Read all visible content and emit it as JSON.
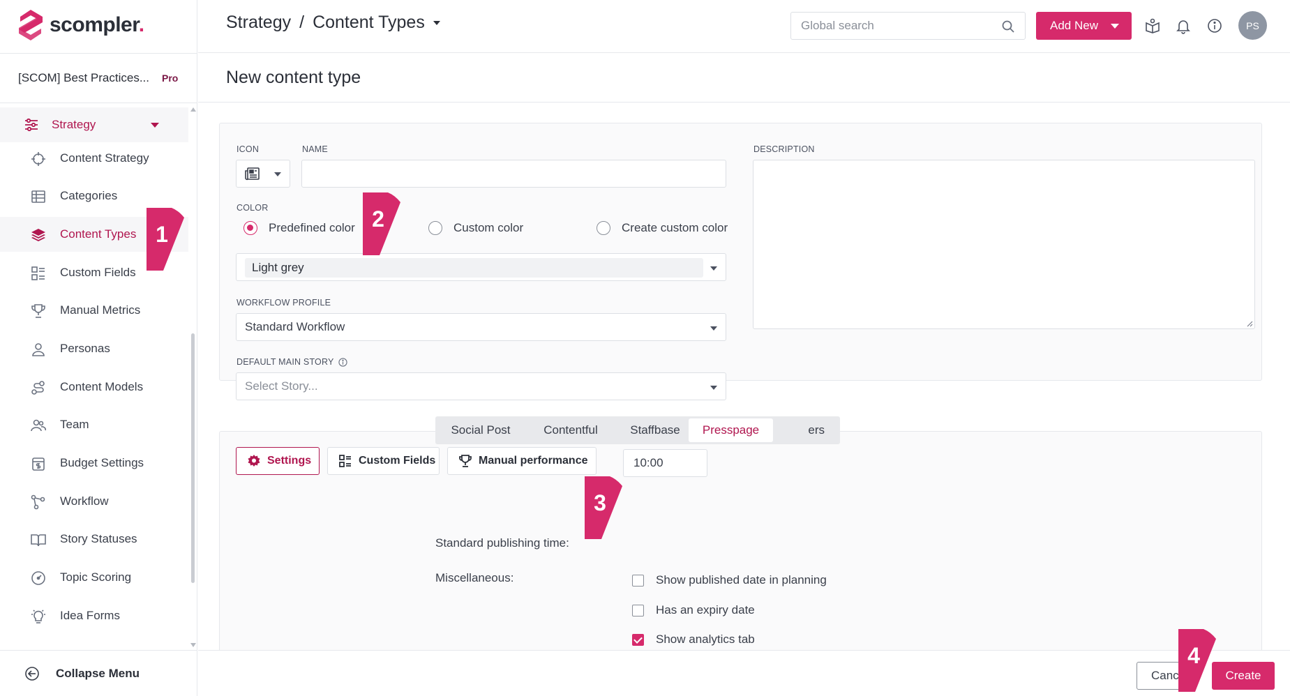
{
  "app": {
    "logo_text": "scompler",
    "logo_dot": "."
  },
  "workspace": {
    "name": "[SCOM] Best Practices...",
    "plan": "Pro"
  },
  "sidebar": {
    "group_label": "Strategy",
    "items": [
      {
        "label": "Content Strategy",
        "icon": "crosshair-icon"
      },
      {
        "label": "Categories",
        "icon": "table-icon"
      },
      {
        "label": "Content Types",
        "icon": "layers-icon",
        "active": true
      },
      {
        "label": "Custom Fields",
        "icon": "grid-list-icon"
      },
      {
        "label": "Manual Metrics",
        "icon": "trophy-icon"
      },
      {
        "label": "Personas",
        "icon": "person-icon"
      },
      {
        "label": "Content Models",
        "icon": "model-icon"
      },
      {
        "label": "Team",
        "icon": "team-icon"
      },
      {
        "label": "Budget Settings",
        "icon": "budget-icon"
      },
      {
        "label": "Workflow",
        "icon": "workflow-icon"
      },
      {
        "label": "Story Statuses",
        "icon": "book-icon"
      },
      {
        "label": "Topic Scoring",
        "icon": "gauge-icon"
      },
      {
        "label": "Idea Forms",
        "icon": "lightbulb-icon"
      }
    ],
    "collapse_label": "Collapse Menu"
  },
  "header": {
    "breadcrumb_root": "Strategy",
    "breadcrumb_sep": "/",
    "breadcrumb_current": "Content Types",
    "search_placeholder": "Global search",
    "add_new_label": "Add New",
    "avatar_initials": "PS"
  },
  "page": {
    "title": "New content type"
  },
  "form": {
    "icon_label": "ICON",
    "name_label": "NAME",
    "name_value": "",
    "description_label": "DESCRIPTION",
    "color_label": "COLOR",
    "color_options": [
      "Predefined color",
      "Custom color",
      "Create custom color"
    ],
    "color_selected": "Light grey",
    "workflow_label": "WORKFLOW PROFILE",
    "workflow_value": "Standard Workflow",
    "main_story_label": "DEFAULT MAIN STORY",
    "main_story_placeholder": "Select Story..."
  },
  "settings": {
    "tabs": [
      {
        "label": "Settings",
        "icon": "gear-icon",
        "active": true
      },
      {
        "label": "Custom Fields",
        "icon": "grid-list-icon"
      },
      {
        "label": "Manual performance",
        "icon": "trophy-icon"
      }
    ],
    "channels": [
      "Social Post",
      "Contentful",
      "Staffbase",
      "Presspage",
      "ers"
    ],
    "active_channel": "Presspage",
    "publishing_time_label": "Standard publishing time:",
    "publishing_time_value": "10:00",
    "misc_label": "Miscellaneous:",
    "checkboxes": [
      {
        "label": "Show published date in planning",
        "checked": false
      },
      {
        "label": "Has an expiry date",
        "checked": false
      },
      {
        "label": "Show analytics tab",
        "checked": true
      }
    ]
  },
  "footer": {
    "cancel_label": "Canc",
    "create_label": "Create"
  },
  "callouts": [
    "1",
    "2",
    "3",
    "4"
  ],
  "colors": {
    "brand": "#d62a6b",
    "brand_dark": "#b0164f"
  }
}
